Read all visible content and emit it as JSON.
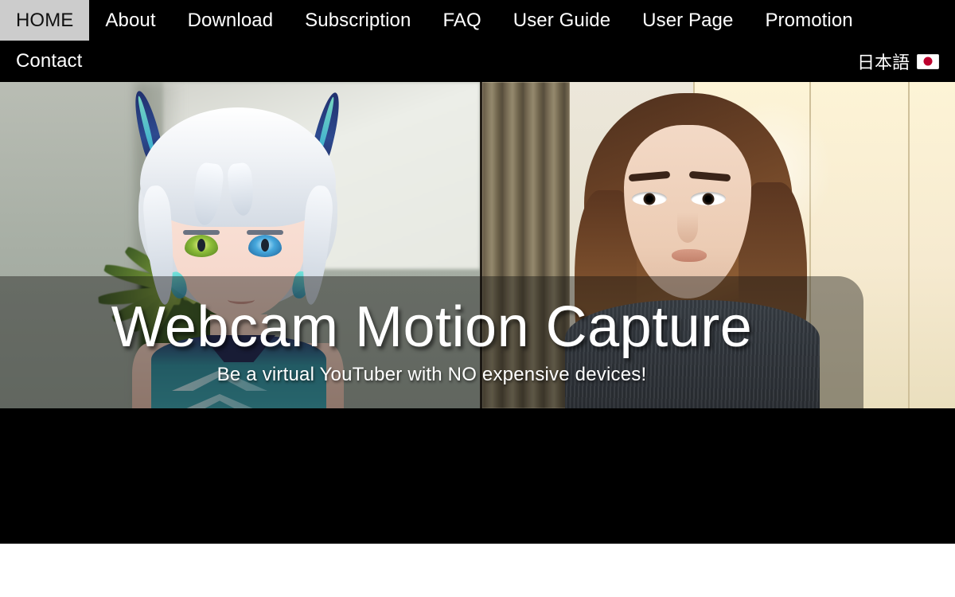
{
  "nav": {
    "primary": [
      {
        "label": "HOME",
        "active": true
      },
      {
        "label": "About",
        "active": false
      },
      {
        "label": "Download",
        "active": false
      },
      {
        "label": "Subscription",
        "active": false
      },
      {
        "label": "FAQ",
        "active": false
      },
      {
        "label": "User Guide",
        "active": false
      },
      {
        "label": "User Page",
        "active": false
      },
      {
        "label": "Promotion",
        "active": false
      }
    ],
    "secondary": [
      {
        "label": "Contact",
        "active": false
      }
    ],
    "language": {
      "label": "日本語",
      "flag_icon": "japan-flag-icon"
    },
    "colors": {
      "bar_background": "#000000",
      "active_background": "#cccccc",
      "active_text": "#111111",
      "text": "#ffffff"
    }
  },
  "hero": {
    "title": "Webcam Motion Capture",
    "subtitle": "Be a virtual YouTuber with NO expensive devices!",
    "overlay_color": "rgba(20,18,16,0.42)",
    "title_color": "#ffffff",
    "left_panel_alt": "anime vtuber avatar with white hair and green and blue eyes in front of a houseplant",
    "right_panel_alt": "woman with long brown hair in a gray knit sweater in front of beige closet doors"
  },
  "page": {
    "below_hero_background": "#000000",
    "bottom_background": "#ffffff"
  }
}
